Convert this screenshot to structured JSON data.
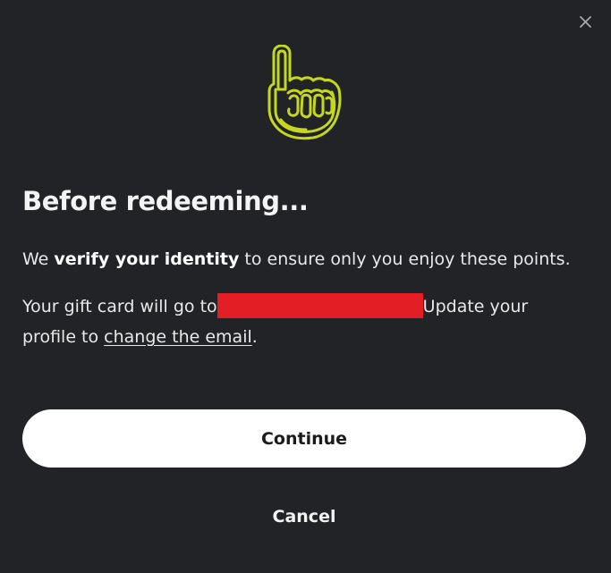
{
  "dialog": {
    "close_icon": "close-icon",
    "hero_icon": "pointing-finger-icon",
    "title": "Before redeeming...",
    "verify": {
      "before": "We ",
      "bold": "verify your identity",
      "after": " to ensure only you enjoy these points."
    },
    "giftcard": {
      "before": "Your gift card will go to",
      "after": "Update your",
      "line2_before": "profile to ",
      "link": "change the email",
      "line2_after": "."
    },
    "continue_label": "Continue",
    "cancel_label": "Cancel"
  },
  "colors": {
    "background": "#222327",
    "accent_icon": "#c6d81e",
    "redaction": "#e31e24",
    "button_bg": "#ffffff"
  }
}
